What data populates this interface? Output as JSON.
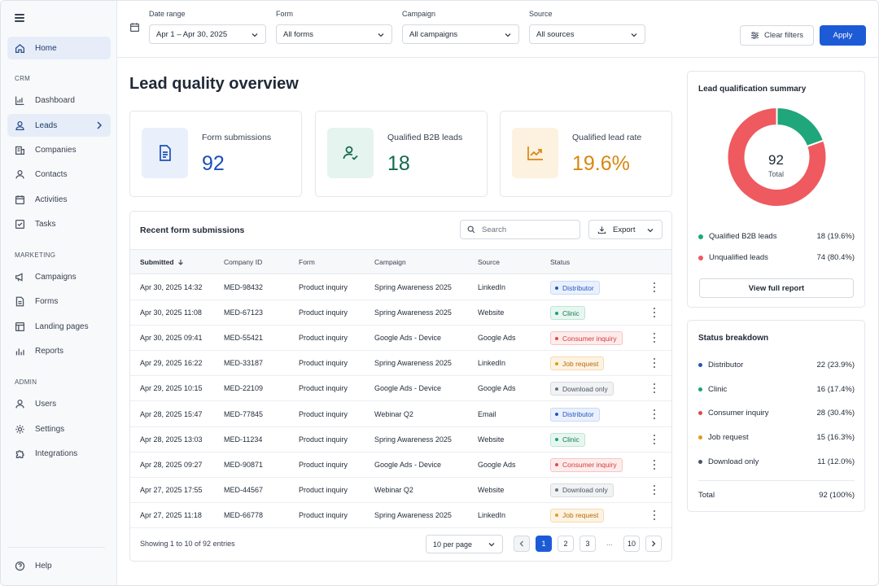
{
  "sidebar": {
    "home": "Home",
    "sections": {
      "crm": "CRM",
      "marketing": "MARKETING",
      "admin": "ADMIN"
    },
    "crm_items": [
      "Dashboard",
      "Leads",
      "Companies",
      "Contacts",
      "Activities",
      "Tasks"
    ],
    "marketing_items": [
      "Campaigns",
      "Forms",
      "Landing pages",
      "Reports"
    ],
    "admin_items": [
      "Users",
      "Settings",
      "Integrations"
    ],
    "help": "Help"
  },
  "filters": {
    "date": {
      "label": "Date range",
      "value": "Apr 1 – Apr 30, 2025"
    },
    "form": {
      "label": "Form",
      "value": "All forms"
    },
    "campaign": {
      "label": "Campaign",
      "value": "All campaigns"
    },
    "source": {
      "label": "Source",
      "value": "All sources"
    },
    "clear_label": "Clear filters",
    "apply_label": "Apply"
  },
  "page_title": "Lead quality overview",
  "kpis": [
    {
      "label": "Form submissions",
      "value": "92",
      "color": "#1d4fb8",
      "bg": "#eaf0fb",
      "icon": "document-icon"
    },
    {
      "label": "Qualified B2B leads",
      "value": "18",
      "color": "#12694f",
      "bg": "#e5f4ee",
      "icon": "user-check-icon"
    },
    {
      "label": "Qualified lead rate",
      "value": "19.6%",
      "color": "#d9860f",
      "bg": "#fdf1e0",
      "icon": "trend-up-icon"
    }
  ],
  "table": {
    "title": "Recent form submissions",
    "search_placeholder": "Search",
    "export_label": "Export",
    "columns": [
      "Submitted",
      "Company ID",
      "Form",
      "Campaign",
      "Source",
      "Status"
    ],
    "rows": [
      {
        "submitted": "Apr 30, 2025 14:32",
        "company": "MED-98432",
        "form": "Product inquiry",
        "campaign": "Spring Awareness 2025",
        "source": "LinkedIn",
        "status": "Distributor"
      },
      {
        "submitted": "Apr 30, 2025 11:08",
        "company": "MED-67123",
        "form": "Product inquiry",
        "campaign": "Spring Awareness 2025",
        "source": "Website",
        "status": "Clinic"
      },
      {
        "submitted": "Apr 30, 2025 09:41",
        "company": "MED-55421",
        "form": "Product inquiry",
        "campaign": "Google Ads - Device",
        "source": "Google Ads",
        "status": "Consumer inquiry"
      },
      {
        "submitted": "Apr 29, 2025 16:22",
        "company": "MED-33187",
        "form": "Product inquiry",
        "campaign": "Spring Awareness 2025",
        "source": "LinkedIn",
        "status": "Job request"
      },
      {
        "submitted": "Apr 29, 2025 10:15",
        "company": "MED-22109",
        "form": "Product inquiry",
        "campaign": "Google Ads - Device",
        "source": "Google Ads",
        "status": "Download only"
      },
      {
        "submitted": "Apr 28, 2025 15:47",
        "company": "MED-77845",
        "form": "Product inquiry",
        "campaign": "Webinar Q2",
        "source": "Email",
        "status": "Distributor"
      },
      {
        "submitted": "Apr 28, 2025 13:03",
        "company": "MED-11234",
        "form": "Product inquiry",
        "campaign": "Spring Awareness 2025",
        "source": "Website",
        "status": "Clinic"
      },
      {
        "submitted": "Apr 28, 2025 09:27",
        "company": "MED-90871",
        "form": "Product inquiry",
        "campaign": "Google Ads - Device",
        "source": "Google Ads",
        "status": "Consumer inquiry"
      },
      {
        "submitted": "Apr 27, 2025 17:55",
        "company": "MED-44567",
        "form": "Product inquiry",
        "campaign": "Webinar Q2",
        "source": "Website",
        "status": "Download only"
      },
      {
        "submitted": "Apr 27, 2025 11:18",
        "company": "MED-66778",
        "form": "Product inquiry",
        "campaign": "Spring Awareness 2025",
        "source": "LinkedIn",
        "status": "Job request"
      }
    ],
    "showing": "Showing 1 to 10 of 92 entries",
    "per_page": "10 per page",
    "pages": [
      "1",
      "2",
      "3",
      "10"
    ],
    "ellipsis": "...",
    "current_page": "1"
  },
  "status_colors": {
    "Distributor": {
      "fg": "#2457c5",
      "bg": "#eaf1fd",
      "border": "#c9daf8",
      "dot": "#2457c5"
    },
    "Clinic": {
      "fg": "#11795a",
      "bg": "#e8f6f0",
      "border": "#bfe5d5",
      "dot": "#16a37a"
    },
    "Consumer inquiry": {
      "fg": "#d63a3a",
      "bg": "#fdecec",
      "border": "#f6c5c5",
      "dot": "#e5484d"
    },
    "Job request": {
      "fg": "#b86a06",
      "bg": "#fdf3e3",
      "border": "#f4dcb0",
      "dot": "#e59a1c"
    },
    "Download only": {
      "fg": "#4b5563",
      "bg": "#f1f2f4",
      "border": "#d8dbe0",
      "dot": "#6b7280"
    }
  },
  "summary": {
    "title": "Lead qualification summary",
    "total_value": "92",
    "total_label": "Total",
    "qualified": {
      "label": "Qualified B2B leads",
      "value": "18 (19.6%)",
      "count": 18,
      "color": "#1fa67a"
    },
    "unqualified": {
      "label": "Unqualified leads",
      "value": "74 (80.4%)",
      "count": 74,
      "color": "#ee5a5f"
    },
    "button": "View full report"
  },
  "breakdown": {
    "title": "Status breakdown",
    "items": [
      {
        "label": "Distributor",
        "value": "22 (23.9%)",
        "color": "#2457c5"
      },
      {
        "label": "Clinic",
        "value": "16 (17.4%)",
        "color": "#16a37a"
      },
      {
        "label": "Consumer inquiry",
        "value": "28 (30.4%)",
        "color": "#e5484d"
      },
      {
        "label": "Job request",
        "value": "15 (16.3%)",
        "color": "#e59a1c"
      },
      {
        "label": "Download only",
        "value": "11 (12.0%)",
        "color": "#4b5563"
      }
    ],
    "total_label": "Total",
    "total_value": "92 (100%)"
  }
}
